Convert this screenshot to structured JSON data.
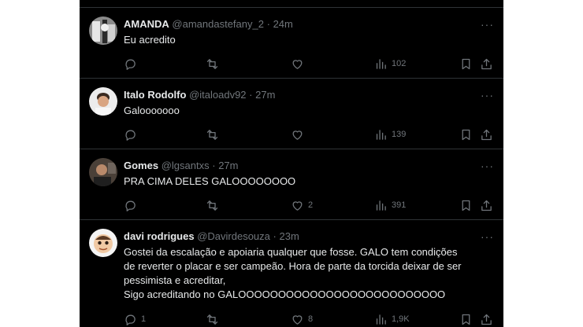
{
  "tweets": [
    {
      "name": "AMANDA",
      "handle": "@amandastefany_2",
      "separator": "·",
      "time": "24m",
      "text": "Eu acredito",
      "replies": "",
      "retweets": "",
      "likes": "",
      "views": "102"
    },
    {
      "name": "Italo Rodolfo",
      "handle": "@italoadv92",
      "separator": "·",
      "time": "27m",
      "text": "Galooooooo",
      "replies": "",
      "retweets": "",
      "likes": "",
      "views": "139"
    },
    {
      "name": "Gomes",
      "handle": "@lgsantxs",
      "separator": "·",
      "time": "27m",
      "text": "PRA CIMA DELES GALOOOOOOOO",
      "replies": "",
      "retweets": "",
      "likes": "2",
      "views": "391"
    },
    {
      "name": "davi rodrigues",
      "handle": "@Davirdesouza",
      "separator": "·",
      "time": "23m",
      "text": "Gostei da escalação e apoiaria qualquer que fosse.  GALO tem condições\nde reverter o placar e ser campeão. Hora de parte da torcida deixar de ser\npessimista e acreditar,\nSigo acreditando no GALOOOOOOOOOOOOOOOOOOOOOOOOOO",
      "replies": "1",
      "retweets": "",
      "likes": "8",
      "views": "1,9K"
    }
  ],
  "more_glyph": "···",
  "colors": {
    "background": "#000000",
    "text": "#e7e9ea",
    "muted": "#71767b",
    "divider": "#2f3336"
  },
  "icons": [
    "reply-icon",
    "retweet-icon",
    "like-icon",
    "views-icon",
    "bookmark-icon",
    "share-icon",
    "more-icon"
  ]
}
